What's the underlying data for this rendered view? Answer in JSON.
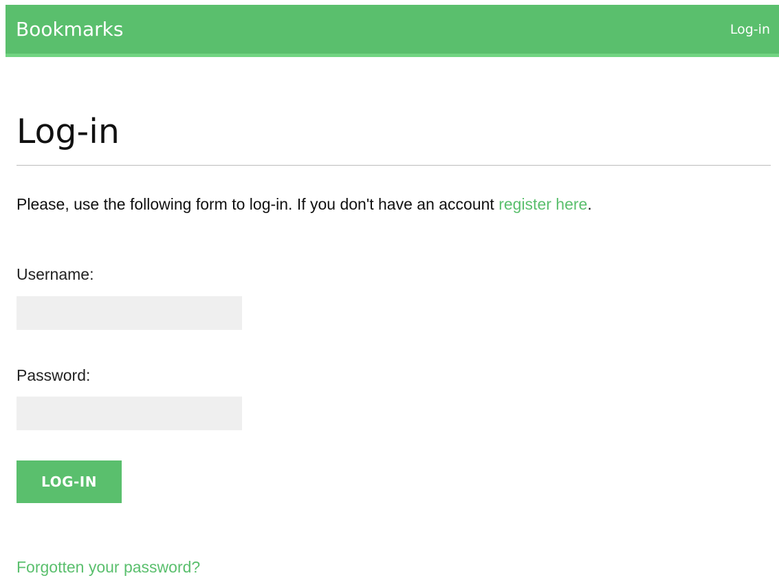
{
  "header": {
    "brand": "Bookmarks",
    "login_link": "Log-in"
  },
  "page": {
    "title": "Log-in",
    "intro_text": "Please, use the following form to log-in. If you don't have an account ",
    "register_link": "register here",
    "intro_end": "."
  },
  "form": {
    "username_label": "Username:",
    "username_value": "",
    "password_label": "Password:",
    "password_value": "",
    "submit_label": "LOG-IN"
  },
  "footer": {
    "forgot_link": "Forgotten your password?"
  },
  "colors": {
    "accent": "#5abf6d",
    "header_border": "#72d482",
    "field_bg": "#efefef"
  }
}
